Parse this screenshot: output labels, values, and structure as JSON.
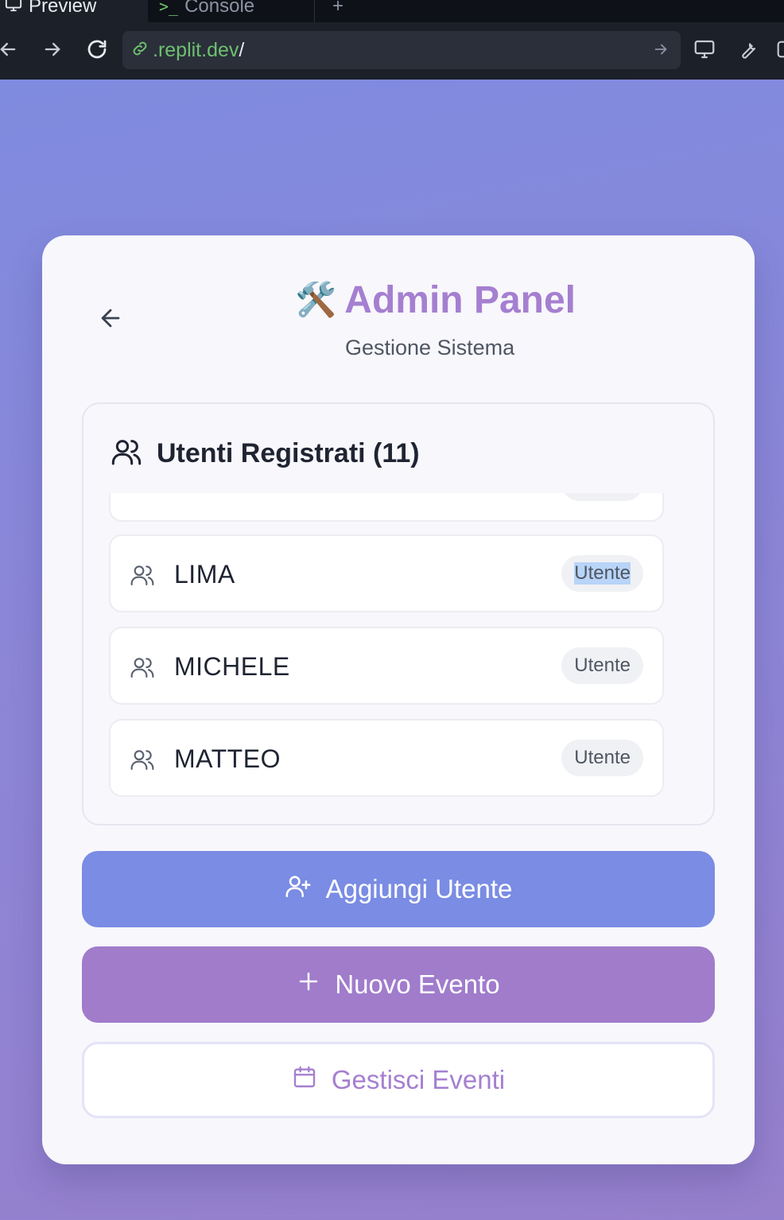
{
  "browser": {
    "tabs": [
      {
        "label": "Preview"
      },
      {
        "label": "Console"
      }
    ],
    "add_tab_label": "+",
    "url": {
      "domain": ".replit.dev",
      "path": "/"
    }
  },
  "header": {
    "emoji": "🛠️",
    "title": "Admin Panel",
    "subtitle": "Gestione Sistema"
  },
  "users": {
    "title": "Utenti Registrati (11)",
    "items": [
      {
        "name": "",
        "role": "Utente"
      },
      {
        "name": "LIMA",
        "role": "Utente"
      },
      {
        "name": "MICHELE",
        "role": "Utente"
      },
      {
        "name": "MATTEO",
        "role": "Utente"
      }
    ]
  },
  "actions": {
    "add_user": "Aggiungi Utente",
    "new_event": "Nuovo Evento",
    "manage_events": "Gestisci Eventi"
  },
  "colors": {
    "accent_purple": "#a57fd0",
    "button_blue": "#7a8ce3",
    "button_purple": "#a07ccb"
  }
}
